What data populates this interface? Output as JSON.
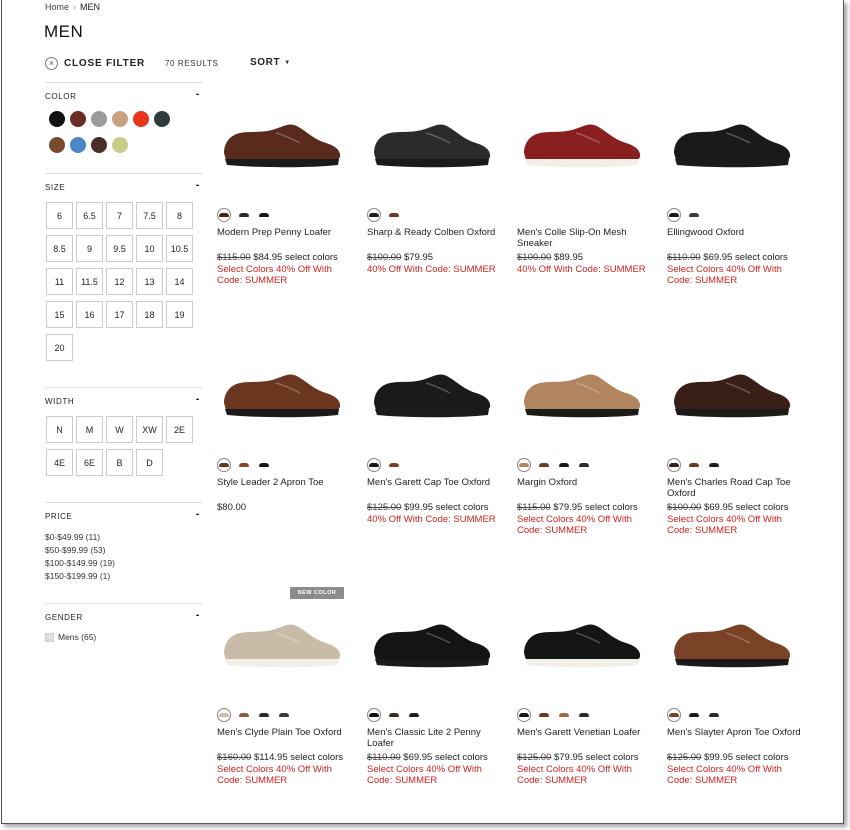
{
  "breadcrumb": {
    "home": "Home",
    "separator": "›",
    "current": "MEN"
  },
  "page_title": "MEN",
  "toolbar": {
    "close_filter": "CLOSE FILTER",
    "results": "70 RESULTS",
    "sort": "SORT",
    "sort_caret": "▼",
    "close_icon": "×"
  },
  "filters": {
    "color": {
      "label": "COLOR",
      "collapse": "-",
      "swatches": [
        "#111111",
        "#6b2e24",
        "#9b9b9b",
        "#caa283",
        "#e8361d",
        "#2f3b3b",
        "#7a4a2c",
        "#4a86c8",
        "#4a2e25",
        "#c7ce8a"
      ]
    },
    "size": {
      "label": "SIZE",
      "collapse": "-",
      "options": [
        "6",
        "6.5",
        "7",
        "7.5",
        "8",
        "8.5",
        "9",
        "9.5",
        "10",
        "10.5",
        "11",
        "11.5",
        "12",
        "13",
        "14",
        "15",
        "16",
        "17",
        "18",
        "19",
        "20"
      ]
    },
    "width": {
      "label": "WIDTH",
      "collapse": "-",
      "options": [
        "N",
        "M",
        "W",
        "XW",
        "2E",
        "4E",
        "6E",
        "B",
        "D"
      ]
    },
    "price": {
      "label": "PRICE",
      "collapse": "-",
      "options": [
        "$0-$49.99 (11)",
        "$50-$99.99 (53)",
        "$100-$149.99 (19)",
        "$150-$199.99 (1)"
      ]
    },
    "gender": {
      "label": "GENDER",
      "collapse": "-",
      "options": [
        "Mens (65)"
      ]
    }
  },
  "badge_new_color": "NEW COLOR",
  "products": [
    {
      "name": "Modern Prep Penny Loafer",
      "orig": "$115.00",
      "price": "$84.95 select colors",
      "promo": "Select Colors 40% Off With Code: SUMMER",
      "color": "#5a2a1c",
      "swatches": [
        "#4a2218",
        "#2a2a2a",
        "#1a1a1a"
      ]
    },
    {
      "name": "Sharp & Ready Colben Oxford",
      "orig": "$100.00",
      "price": "$79.95",
      "promo": "40% Off With Code: SUMMER",
      "color": "#2b2b2b",
      "swatches": [
        "#1e1e1e",
        "#6b3a22"
      ]
    },
    {
      "name": "Men's Colle Slip-On Mesh Sneaker",
      "orig": "$100.00",
      "price": "$89.95",
      "promo": "40% Off With Code: SUMMER",
      "color": "#8a1f1f",
      "swatches": []
    },
    {
      "name": "Ellingwood Oxford",
      "orig": "$110.00",
      "price": "$69.95 select colors",
      "promo": "Select Colors 40% Off With Code: SUMMER",
      "color": "#1a1a1a",
      "swatches": [
        "#1a1a1a",
        "#3a3a3a"
      ]
    },
    {
      "name": "Style Leader 2 Apron Toe",
      "orig": "",
      "price": "$80.00",
      "promo": "",
      "color": "#6a3620",
      "swatches": [
        "#6a3620",
        "#8b4a2a",
        "#1a1a1a"
      ]
    },
    {
      "name": "Men's Garett Cap Toe Oxford",
      "orig": "$125.00",
      "price": "$99.95 select colors",
      "promo": "40% Off With Code: SUMMER",
      "color": "#1a1a1a",
      "swatches": [
        "#1a1a1a",
        "#7a4028"
      ]
    },
    {
      "name": "Margin Oxford",
      "orig": "$115.00",
      "price": "$79.95 select colors",
      "promo": "Select Colors 40% Off With Code: SUMMER",
      "color": "#b08560",
      "swatches": [
        "#b08560",
        "#6b3a22",
        "#1a1a1a",
        "#2a2a2a"
      ]
    },
    {
      "name": "Men's Charles Road Cap Toe Oxford",
      "orig": "$100.00",
      "price": "$69.95 select colors",
      "promo": "Select Colors 40% Off With Code: SUMMER",
      "color": "#3a1e18",
      "swatches": [
        "#3a1e18",
        "#6b3a22",
        "#1a1a1a"
      ]
    },
    {
      "name": "Men's Clyde Plain Toe Oxford",
      "orig": "$160.00",
      "price": "$114.95 select colors",
      "promo": "Select Colors 40% Off With Code: SUMMER",
      "color": "#c8bca8",
      "swatches": [
        "#c8bca8",
        "#8a5a3a",
        "#2a2a2a",
        "#3a3a3a"
      ]
    },
    {
      "name": "Men's Classic Lite 2 Penny Loafer",
      "orig": "$110.00",
      "price": "$69.95 select colors",
      "promo": "Select Colors 40% Off With Code: SUMMER",
      "color": "#141414",
      "swatches": [
        "#141414",
        "#3a2a22",
        "#1e1e1e"
      ]
    },
    {
      "name": "Men's Garett Venetian Loafer",
      "orig": "$125.00",
      "price": "$79.95 select colors",
      "promo": "Select Colors 40% Off With Code: SUMMER",
      "color": "#151515",
      "swatches": [
        "#151515",
        "#6a3620",
        "#a06848",
        "#2a2a2a"
      ]
    },
    {
      "name": "Men's Slayter Apron Toe Oxford",
      "orig": "$125.00",
      "price": "$99.95 select colors",
      "promo": "Select Colors 40% Off With Code: SUMMER",
      "color": "#7a4226",
      "swatches": [
        "#7a4226",
        "#1a1a1a",
        "#2a2a2a"
      ]
    }
  ]
}
